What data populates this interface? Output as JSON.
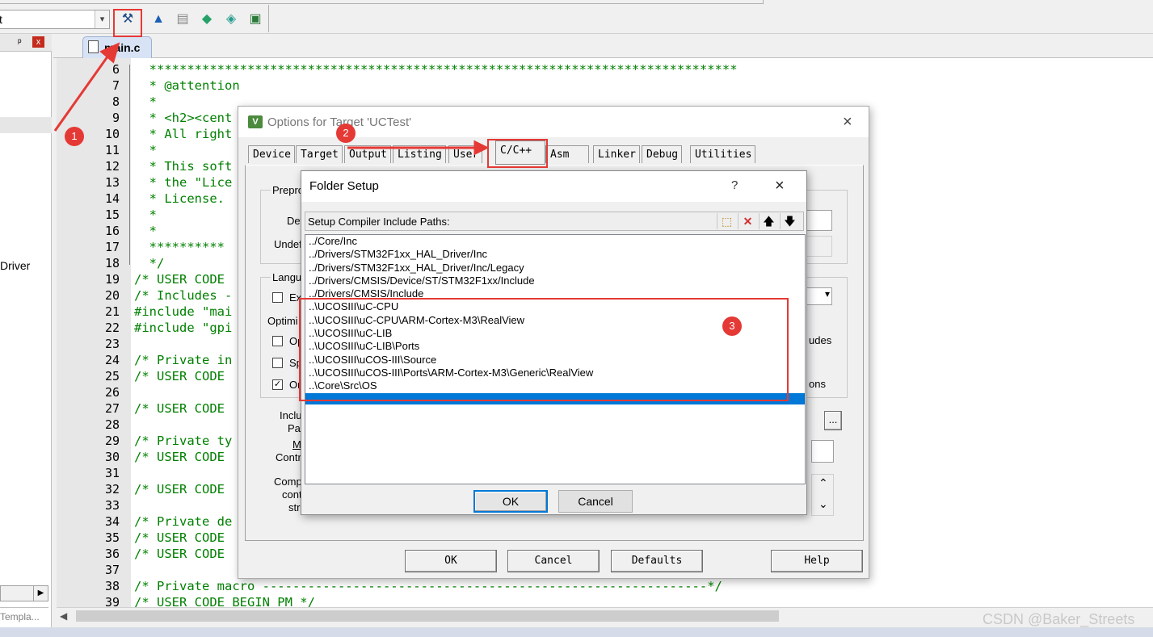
{
  "toolbar": {
    "target_combo": "t",
    "buttons": [
      {
        "icon": "options-for-target-icon",
        "glyph": "⚒"
      },
      {
        "icon": "manage-components-icon",
        "glyph": "▲"
      },
      {
        "icon": "file-extensions-icon",
        "glyph": "▤"
      },
      {
        "icon": "manage-packs-icon",
        "glyph": "◆"
      },
      {
        "icon": "select-packs-icon",
        "glyph": "◈"
      },
      {
        "icon": "run-time-environment-icon",
        "glyph": "▣"
      }
    ]
  },
  "project_pane": {
    "pin": "ᵖ",
    "close": "x",
    "tree_item": "Driver",
    "bottom_tab": "Templa..."
  },
  "editor": {
    "file_tab": "main.c",
    "lines": [
      {
        "n": "6",
        "text": "  ******************************************************************************"
      },
      {
        "n": "7",
        "text": "  * @attention"
      },
      {
        "n": "8",
        "text": "  *"
      },
      {
        "n": "9",
        "text": "  * <h2><cent"
      },
      {
        "n": "10",
        "text": "  * All right"
      },
      {
        "n": "11",
        "text": "  *"
      },
      {
        "n": "12",
        "text": "  * This soft"
      },
      {
        "n": "13",
        "text": "  * the \"Lice"
      },
      {
        "n": "14",
        "text": "  * License."
      },
      {
        "n": "15",
        "text": "  *"
      },
      {
        "n": "16",
        "text": "  *"
      },
      {
        "n": "17",
        "text": "  **********"
      },
      {
        "n": "18",
        "text": "  */"
      },
      {
        "n": "19",
        "text": "/* USER CODE"
      },
      {
        "n": "20",
        "text": "/* Includes -"
      },
      {
        "n": "21",
        "text": "#include \"mai"
      },
      {
        "n": "22",
        "text": "#include \"gpi"
      },
      {
        "n": "23",
        "text": ""
      },
      {
        "n": "24",
        "text": "/* Private in"
      },
      {
        "n": "25",
        "text": "/* USER CODE"
      },
      {
        "n": "26",
        "text": ""
      },
      {
        "n": "27",
        "text": "/* USER CODE"
      },
      {
        "n": "28",
        "text": ""
      },
      {
        "n": "29",
        "text": "/* Private ty"
      },
      {
        "n": "30",
        "text": "/* USER CODE"
      },
      {
        "n": "31",
        "text": ""
      },
      {
        "n": "32",
        "text": "/* USER CODE"
      },
      {
        "n": "33",
        "text": ""
      },
      {
        "n": "34",
        "text": "/* Private de"
      },
      {
        "n": "35",
        "text": "/* USER CODE"
      },
      {
        "n": "36",
        "text": "/* USER CODE"
      },
      {
        "n": "37",
        "text": ""
      },
      {
        "n": "38",
        "text": "/* Private macro -----------------------------------------------------------*/"
      },
      {
        "n": "39",
        "text": "/* USER CODE BEGIN PM */"
      }
    ]
  },
  "options_dialog": {
    "title": "Options for Target 'UCTest'",
    "close": "×",
    "tabs": [
      "Device",
      "Target",
      "Output",
      "Listing",
      "User",
      "C/C++",
      "Asm",
      "Linker",
      "Debug",
      "Utilities"
    ],
    "active_tab": "C/C++",
    "partial_labels": {
      "preprocessor": "Prepro",
      "define": "Def",
      "undefine": "Undef",
      "language": "Langu",
      "execute": "Ex",
      "optimization": "Optimi",
      "opt1": "Op",
      "opt2": "Sp",
      "opt3": "On",
      "include_paths_1": "Inclu",
      "include_paths_2": "Pat",
      "misc_1": "Mi",
      "misc_2": "Contr",
      "compiler_1": "Comp",
      "compiler_2": "cont",
      "compiler_3": "stri",
      "includes_right": "udes",
      "options_right": "ons",
      "browse": "...",
      "scroll_up": "⌃",
      "scroll_down": "⌄",
      "dropdown": "▾"
    },
    "buttons": {
      "ok": "OK",
      "cancel": "Cancel",
      "defaults": "Defaults",
      "help": "Help"
    }
  },
  "folder_setup": {
    "title": "Folder Setup",
    "help": "?",
    "close": "×",
    "header_label": "Setup Compiler Include Paths:",
    "tool_buttons": [
      {
        "name": "new-folder-icon",
        "glyph": "⬚"
      },
      {
        "name": "delete-icon",
        "glyph": "✕"
      },
      {
        "name": "move-up-icon",
        "glyph": "🡅"
      },
      {
        "name": "move-down-icon",
        "glyph": "🡇"
      }
    ],
    "paths": [
      "../Core/Inc",
      "../Drivers/STM32F1xx_HAL_Driver/Inc",
      "../Drivers/STM32F1xx_HAL_Driver/Inc/Legacy",
      "../Drivers/CMSIS/Device/ST/STM32F1xx/Include",
      "../Drivers/CMSIS/Include",
      "..\\UCOSIII\\uC-CPU",
      "..\\UCOSIII\\uC-CPU\\ARM-Cortex-M3\\RealView",
      "..\\UCOSIII\\uC-LIB",
      "..\\UCOSIII\\uC-LIB\\Ports",
      "..\\UCOSIII\\uCOS-III\\Source",
      "..\\UCOSIII\\uCOS-III\\Ports\\ARM-Cortex-M3\\Generic\\RealView",
      "..\\Core\\Src\\OS",
      ""
    ],
    "selected_index": 12,
    "buttons": {
      "ok": "OK",
      "cancel": "Cancel"
    }
  },
  "annotations": {
    "badge1": "1",
    "badge2": "2",
    "badge3": "3",
    "color": "#e53935"
  },
  "watermark": "CSDN @Baker_Streets"
}
